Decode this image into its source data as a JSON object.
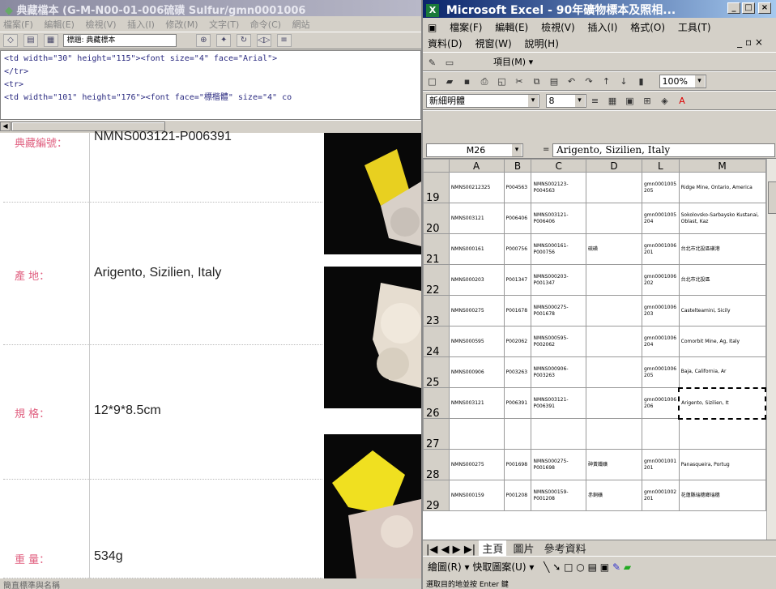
{
  "left_window": {
    "title": "典藏檔本 (G-M-N00-01-006硫磺 Sulfur/gmn0001006",
    "menu": [
      "檔案(F)",
      "編輯(E)",
      "檢視(V)",
      "插入(I)",
      "修改(M)",
      "文字(T)",
      "命令(C)",
      "網站"
    ],
    "toolbar_field": "標題: 典藏標本",
    "code_lines": [
      "<td width=\"30\" height=\"115\"><font size=\"4\" face=\"Arial\">",
      "</tr>",
      "<tr>",
      "<td width=\"101\" height=\"176\"><font face=\"標楷體\" size=\"4\" co"
    ],
    "rows": [
      {
        "label": "典藏編號：",
        "value": "NMNS003121-P006391"
      },
      {
        "label": "產 地：",
        "value": "Arigento, Sizilien, Italy"
      },
      {
        "label": "規 格：",
        "value": "12*9*8.5cm"
      },
      {
        "label": "重 量：",
        "value": "534g"
      }
    ],
    "status": "簡直標準與名稱"
  },
  "excel": {
    "title": "Microsoft Excel - 90年礦物標本及照相...",
    "menu_row1": [
      "檔案(F)",
      "編輯(E)",
      "檢視(V)",
      "插入(I)",
      "格式(O)",
      "工具(T)"
    ],
    "menu_row2": [
      "資料(D)",
      "視窗(W)",
      "說明(H)"
    ],
    "toolbar_items": "項目(M) ▾",
    "zoom": "100%",
    "font_name": "新細明體",
    "font_size": "8",
    "name_box": "M26",
    "formula": "Arigento, Sizilien, Italy",
    "columns": [
      "A",
      "B",
      "C",
      "D",
      "L",
      "M"
    ],
    "rows": [
      {
        "num": "19",
        "a": "NMNS00212325",
        "b": "P004563",
        "c": "NMNS002123-P004563",
        "d": "",
        "l": "gmn0001005 205",
        "m": "Ridge Mine, Ontario, America"
      },
      {
        "num": "20",
        "a": "NMNS003121",
        "b": "P006406",
        "c": "NMNS003121-P006406",
        "d": "",
        "l": "gmn0001005 204",
        "m": "Sokolovsko-Sarbaysko Kustanai, Oblast, Kaz"
      },
      {
        "num": "21",
        "a": "NMNS000161",
        "b": "P000756",
        "c": "NMNS000161-P000756",
        "d": "硫磺",
        "l": "gmn0001006 201",
        "m": "台北市北投區磺港"
      },
      {
        "num": "22",
        "a": "NMNS000203",
        "b": "P001347",
        "c": "NMNS000203-P001347",
        "d": "",
        "l": "gmn0001006 202",
        "m": "台北市北投區"
      },
      {
        "num": "23",
        "a": "NMNS000275",
        "b": "P001678",
        "c": "NMNS000275-P001678",
        "d": "",
        "l": "gmn0001006 203",
        "m": "Castelteamini, Sicily"
      },
      {
        "num": "24",
        "a": "NMNS000595",
        "b": "P002062",
        "c": "NMNS000595-P002062",
        "d": "",
        "l": "gmn0001006 204",
        "m": "Comorbit Mine, Ag, Italy"
      },
      {
        "num": "25",
        "a": "NMNS000906",
        "b": "P003263",
        "c": "NMNS000906-P003263",
        "d": "",
        "l": "gmn0001006 205",
        "m": "Baja, California, Ar"
      },
      {
        "num": "26",
        "a": "NMNS003121",
        "b": "P006391",
        "c": "NMNS003121-P006391",
        "d": "",
        "l": "gmn0001006 206",
        "m": "Arigento, Sizilien, It"
      },
      {
        "num": "27",
        "a": "",
        "b": "",
        "c": "",
        "d": "",
        "l": "",
        "m": ""
      },
      {
        "num": "28",
        "a": "NMNS000275",
        "b": "P001698",
        "c": "NMNS000275-P001698",
        "d": "砷黃鐵礦",
        "l": "gmn0001001 201",
        "m": "Panasqueira, Portug"
      },
      {
        "num": "29",
        "a": "NMNS000159",
        "b": "P001208",
        "c": "NMNS000159-P001208",
        "d": "赤銅礦",
        "l": "gmn0001002 201",
        "m": "花蓮縣瑞穗鄉瑞穗"
      }
    ],
    "sheet_tabs": [
      "主頁",
      "圖片",
      "參考資料"
    ],
    "draw_toolbar": "繪圖(R) ▾   快取圖案(U) ▾",
    "status": "選取目的地並按 Enter 鍵"
  }
}
